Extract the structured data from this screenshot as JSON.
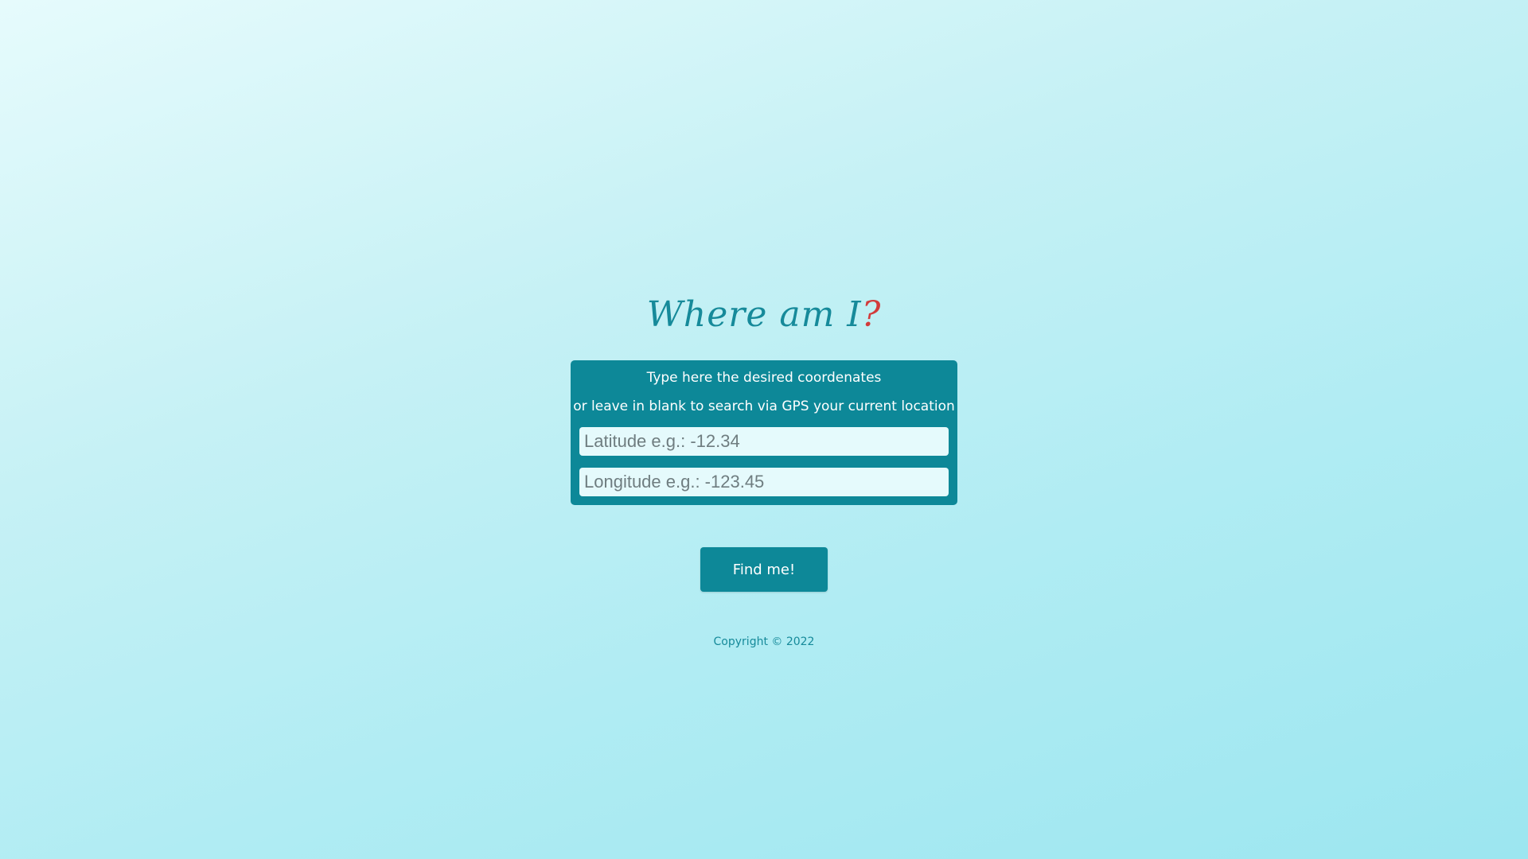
{
  "header": {
    "title_main": "Where am I",
    "title_mark": "?"
  },
  "form": {
    "instruction_line1": "Type here the desired coordenates",
    "instruction_line2": "or leave in blank to search via GPS your current location",
    "latitude": {
      "value": "",
      "placeholder": "Latitude e.g.: -12.34"
    },
    "longitude": {
      "value": "",
      "placeholder": "Longitude e.g.: -123.45"
    }
  },
  "actions": {
    "find_label": "Find me!"
  },
  "footer": {
    "copyright": "Copyright © 2022"
  },
  "colors": {
    "accent": "#0d8898",
    "title": "#168a9a",
    "question_mark": "#d23b3b",
    "input_background": "#e5fafc"
  }
}
